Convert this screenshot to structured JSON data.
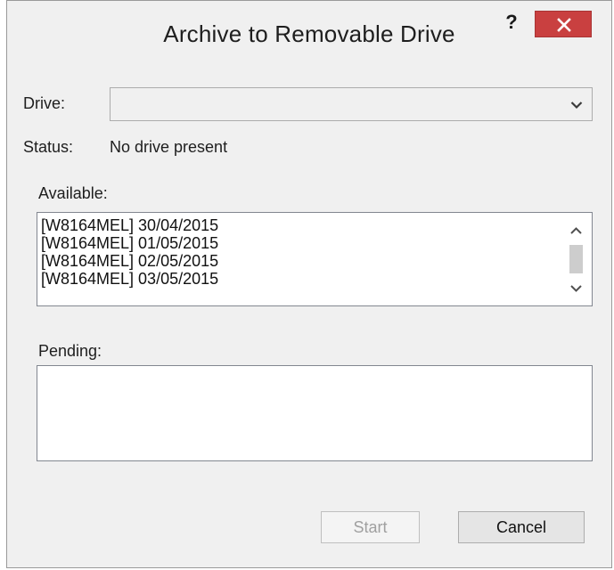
{
  "window": {
    "title": "Archive to Removable Drive",
    "help_label": "?"
  },
  "drive": {
    "label": "Drive:",
    "selected": ""
  },
  "status": {
    "label": "Status:",
    "value": "No drive present"
  },
  "available": {
    "label": "Available:",
    "items": [
      "[W8164MEL] 30/04/2015",
      "[W8164MEL] 01/05/2015",
      "[W8164MEL] 02/05/2015",
      "[W8164MEL] 03/05/2015"
    ]
  },
  "pending": {
    "label": "Pending:",
    "items": []
  },
  "buttons": {
    "start": "Start",
    "cancel": "Cancel"
  },
  "colors": {
    "close_button": "#c94040",
    "dialog_background": "#f0f0f0"
  },
  "icons": {
    "close": "close-icon",
    "dropdown": "chevron-down-icon",
    "scroll_up": "chevron-up-icon",
    "scroll_down": "chevron-down-icon"
  }
}
